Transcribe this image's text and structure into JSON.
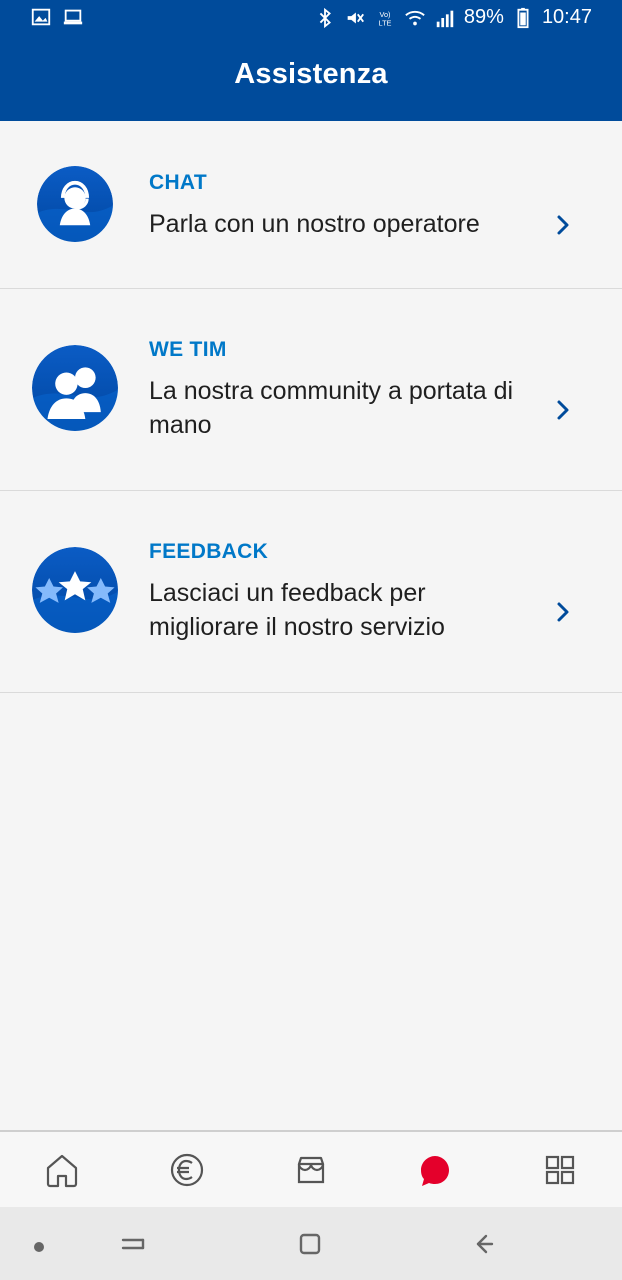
{
  "statusbar": {
    "battery": "89%",
    "time": "10:47",
    "icons": [
      "image-icon",
      "laptop-icon",
      "bluetooth-icon",
      "mute-icon",
      "volte-icon",
      "wifi-icon",
      "signal-icon",
      "battery-icon"
    ]
  },
  "header": {
    "title": "Assistenza"
  },
  "items": [
    {
      "kicker": "CHAT",
      "desc": "Parla con un nostro operatore",
      "icon": "chat-operator-icon"
    },
    {
      "kicker": "WE TIM",
      "desc": "La nostra community a portata di mano",
      "icon": "community-icon"
    },
    {
      "kicker": "FEEDBACK",
      "desc": "Lasciaci un feedback per migliorare il nostro servizio",
      "icon": "stars-icon"
    }
  ],
  "tabs": [
    {
      "name": "home",
      "icon": "home-icon"
    },
    {
      "name": "euro",
      "icon": "euro-icon"
    },
    {
      "name": "store",
      "icon": "store-icon"
    },
    {
      "name": "assistenza",
      "icon": "chat-bubble-icon",
      "active": true
    },
    {
      "name": "more",
      "icon": "grid-icon"
    }
  ],
  "colors": {
    "primary": "#004b9b",
    "kicker": "#0078c8",
    "accent_red": "#e4002b",
    "text": "#1f1f1f",
    "bg": "#f5f5f5"
  }
}
